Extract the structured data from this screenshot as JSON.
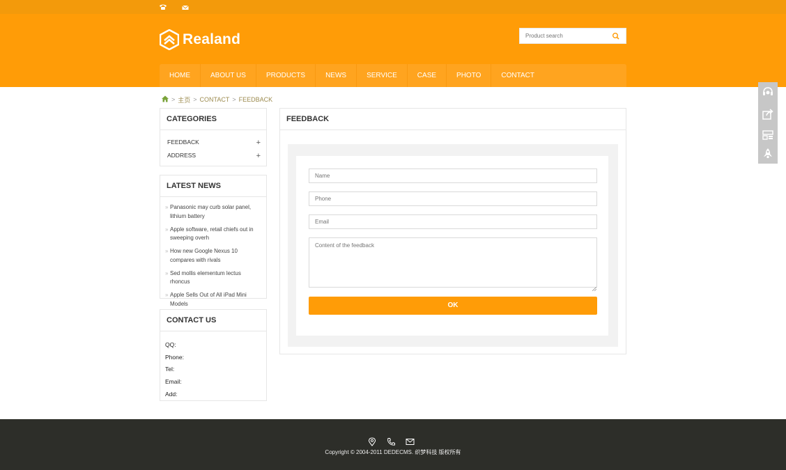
{
  "brand": {
    "name": "Realand"
  },
  "topbar": {
    "icons": [
      "phone-icon",
      "mail-icon"
    ]
  },
  "search": {
    "placeholder": "Product search",
    "icon": "search-icon"
  },
  "nav": {
    "items": [
      {
        "label": "HOME"
      },
      {
        "label": "ABOUT US"
      },
      {
        "label": "PRODUCTS"
      },
      {
        "label": "NEWS"
      },
      {
        "label": "SERVICE"
      },
      {
        "label": "CASE"
      },
      {
        "label": "PHOTO"
      },
      {
        "label": "CONTACT"
      }
    ]
  },
  "breadcrumb": {
    "home_icon": "home-icon",
    "separator": ">",
    "items": [
      "主页",
      "CONTACT",
      "FEEDBACK"
    ]
  },
  "categories": {
    "title": "CATEGORIES",
    "items": [
      {
        "label": "FEEDBACK",
        "toggle": "+"
      },
      {
        "label": "ADDRESS",
        "toggle": "+"
      }
    ]
  },
  "latest_news": {
    "title": "LATEST NEWS",
    "bullet": "»",
    "items": [
      "Panasonic may curb solar panel, lithium battery",
      "Apple software, retail chiefs out in sweeping overh",
      "How new Google Nexus 10 compares with rivals",
      "Sed mollis elementum lectus rhoncus",
      "Apple Sells Out of All iPad Mini Models"
    ]
  },
  "contact_us": {
    "title": "CONTACT US",
    "rows": [
      "QQ:",
      "Phone:",
      "Tel:",
      "Email:",
      "Add:"
    ]
  },
  "feedback": {
    "title": "FEEDBACK",
    "name_placeholder": "Name",
    "phone_placeholder": "Phone",
    "email_placeholder": "Email",
    "content_placeholder": "Content of the feedback",
    "submit_label": "OK"
  },
  "side_tools": [
    "customer-service-icon",
    "share-icon",
    "qr-code-icon",
    "rocket-icon"
  ],
  "footer": {
    "icons": [
      "location-icon",
      "phone-icon",
      "mail-icon"
    ],
    "copyright": "Copyright © 2004-2011 DEDECMS. 织梦科技 版权所有"
  },
  "colors": {
    "accent": "#ff9c07",
    "nav_bar": "#ffa41f",
    "footer_bg": "#2d2e29",
    "breadcrumb_link": "#9c8b4f"
  }
}
